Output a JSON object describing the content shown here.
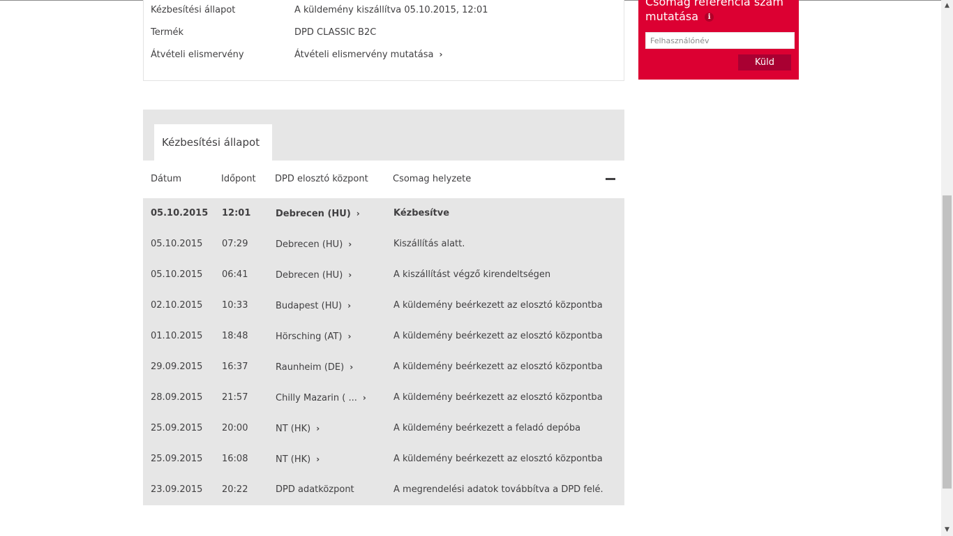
{
  "shipment_info": {
    "rows": [
      {
        "label": "Kézbesítési állapot",
        "value": "A küldemény kiszállítva 05.10.2015, 12:01"
      },
      {
        "label": "Termék",
        "value": "DPD CLASSIC B2C"
      },
      {
        "label": "Átvételi elismervény",
        "value": "Átvételi elismervény mutatása"
      }
    ]
  },
  "reference_box": {
    "title": "Csomag referencia szám mutatása",
    "info_icon": "i",
    "input_placeholder": "Felhasználónév",
    "button_label": "Küld",
    "background_color": "#dc0032"
  },
  "tracking": {
    "tab_label": "Kézbesítési állapot",
    "columns": [
      "Dátum",
      "Időpont",
      "DPD elosztó központ",
      "Csomag helyzete"
    ],
    "rows": [
      {
        "date": "05.10.2015",
        "time": "12:01",
        "hub": "Debrecen (HU)",
        "status": "Kézbesítve"
      },
      {
        "date": "05.10.2015",
        "time": "07:29",
        "hub": "Debrecen (HU)",
        "status": "Kiszállítás alatt."
      },
      {
        "date": "05.10.2015",
        "time": "06:41",
        "hub": "Debrecen (HU)",
        "status": "A kiszállítást végző kirendeltségen"
      },
      {
        "date": "02.10.2015",
        "time": "10:33",
        "hub": "Budapest (HU)",
        "status": "A küldemény beérkezett az elosztó központba"
      },
      {
        "date": "01.10.2015",
        "time": "18:48",
        "hub": "Hörsching (AT)",
        "status": "A küldemény beérkezett az elosztó központba"
      },
      {
        "date": "29.09.2015",
        "time": "16:37",
        "hub": "Raunheim (DE)",
        "status": "A küldemény beérkezett az elosztó központba"
      },
      {
        "date": "28.09.2015",
        "time": "21:57",
        "hub": "Chilly Mazarin ( ...",
        "status": "A küldemény beérkezett az elosztó központba"
      },
      {
        "date": "25.09.2015",
        "time": "20:00",
        "hub": "NT (HK)",
        "status": "A küldemény beérkezett a feladó depóba"
      },
      {
        "date": "25.09.2015",
        "time": "16:08",
        "hub": "NT (HK)",
        "status": "A küldemény beérkezett az elosztó központba"
      },
      {
        "date": "23.09.2015",
        "time": "20:22",
        "hub": "DPD adatközpont",
        "status": "A megrendelési adatok továbbítva a DPD felé."
      }
    ]
  },
  "chevron_glyph": "›"
}
